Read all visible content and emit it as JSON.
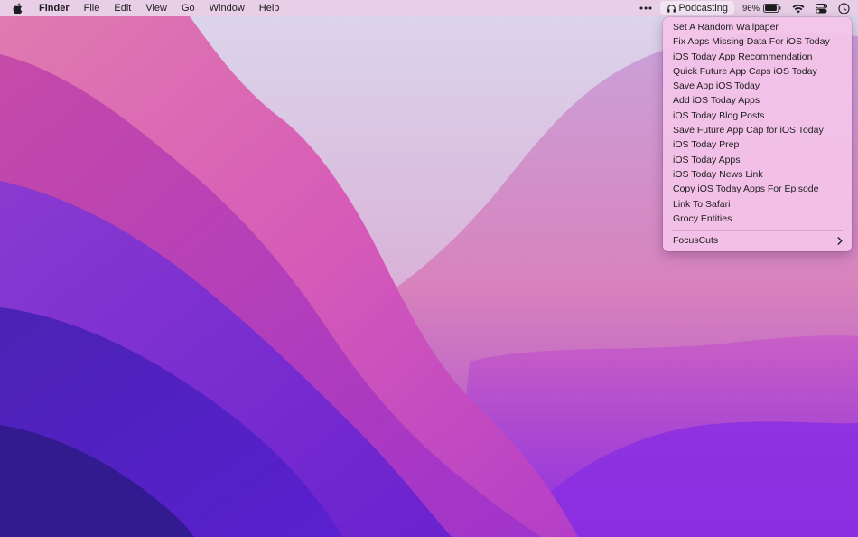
{
  "menubar": {
    "apple_icon": "apple-logo-icon",
    "app_name": "Finder",
    "menus": [
      "File",
      "Edit",
      "View",
      "Go",
      "Window",
      "Help"
    ],
    "status": {
      "more_icon": "ellipsis-icon",
      "podcasting_label": "Podcasting",
      "podcasting_icon": "headphones-icon",
      "battery_percent": "96%",
      "battery_level": 0.96,
      "battery_icon": "battery-icon",
      "wifi_icon": "wifi-icon",
      "control_center_icon": "control-center-icon",
      "clock_icon": "clock-icon"
    }
  },
  "dropdown": {
    "items": [
      "Set A Random Wallpaper",
      "Fix Apps Missing Data For iOS Today",
      "iOS Today App Recommendation",
      "Quick Future App Caps iOS Today",
      "Save App iOS Today",
      "Add iOS Today Apps",
      "iOS Today Blog Posts",
      "Save Future App Cap for iOS Today",
      "iOS Today Prep",
      "iOS Today Apps",
      "iOS Today News Link",
      "Copy iOS Today Apps For Episode",
      "Link To Safari",
      "Grocy Entities"
    ],
    "submenu_label": "FocusCuts",
    "submenu_icon": "chevron-right-icon"
  },
  "colors": {
    "wallpaper_light": "#dcd3ea",
    "wallpaper_pink": "#e86ab8",
    "wallpaper_purple": "#8a2be2",
    "wallpaper_deep": "#3a1aa8",
    "menu_bg": "#f4c4e8"
  }
}
